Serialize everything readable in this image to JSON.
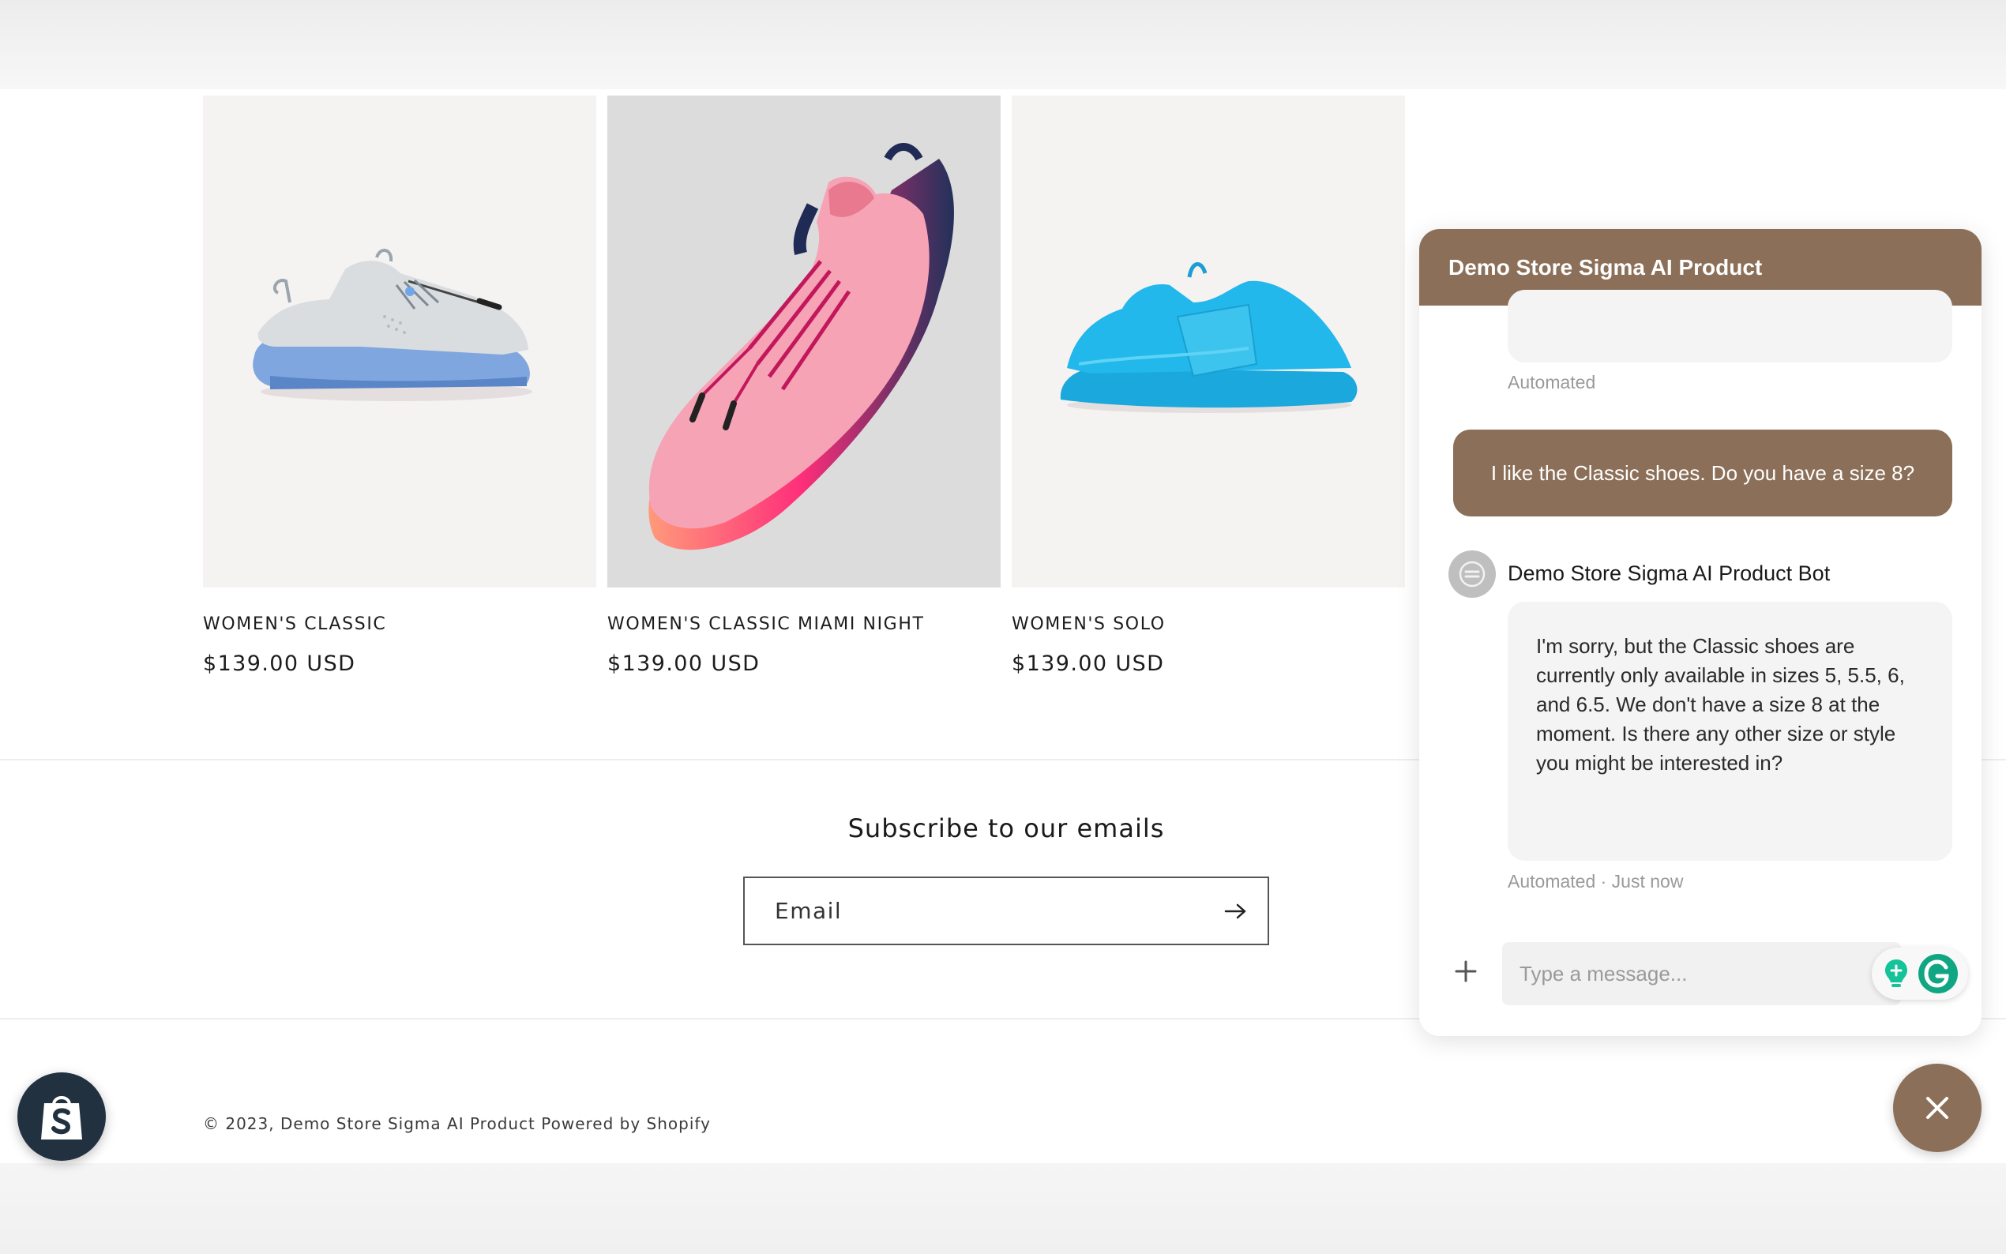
{
  "products": [
    {
      "title": "WOMEN'S CLASSIC",
      "price": "$139.00 USD",
      "image": "grey-white-sneaker-blue-sole"
    },
    {
      "title": "WOMEN'S CLASSIC MIAMI NIGHT",
      "price": "$139.00 USD",
      "image": "pink-sneaker-navy-heel"
    },
    {
      "title": "WOMEN'S SOLO",
      "price": "$139.00 USD",
      "image": "cyan-slip-on-sneaker"
    }
  ],
  "subscribe": {
    "heading": "Subscribe to our emails",
    "email_placeholder": "Email",
    "submit_icon": "arrow-right-icon"
  },
  "footer": {
    "copyright": "© 2023,",
    "store_link": "Demo Store Sigma AI Product",
    "powered_by": "Powered by Shopify"
  },
  "chat": {
    "header_title": "Demo Store Sigma AI Product",
    "prev_meta": "Automated",
    "user_message": "I like the Classic shoes. Do you have a size 8?",
    "bot_name": "Demo Store Sigma AI Product Bot",
    "bot_message": "I'm sorry, but the Classic shoes are currently only available in sizes 5, 5.5, 6, and 6.5. We don't have a size 8 at the moment. Is there any other size or style you might be interested in?",
    "bot_meta": "Automated · Just now",
    "input_placeholder": "Type a message...",
    "accent_color": "#8b6f58"
  }
}
